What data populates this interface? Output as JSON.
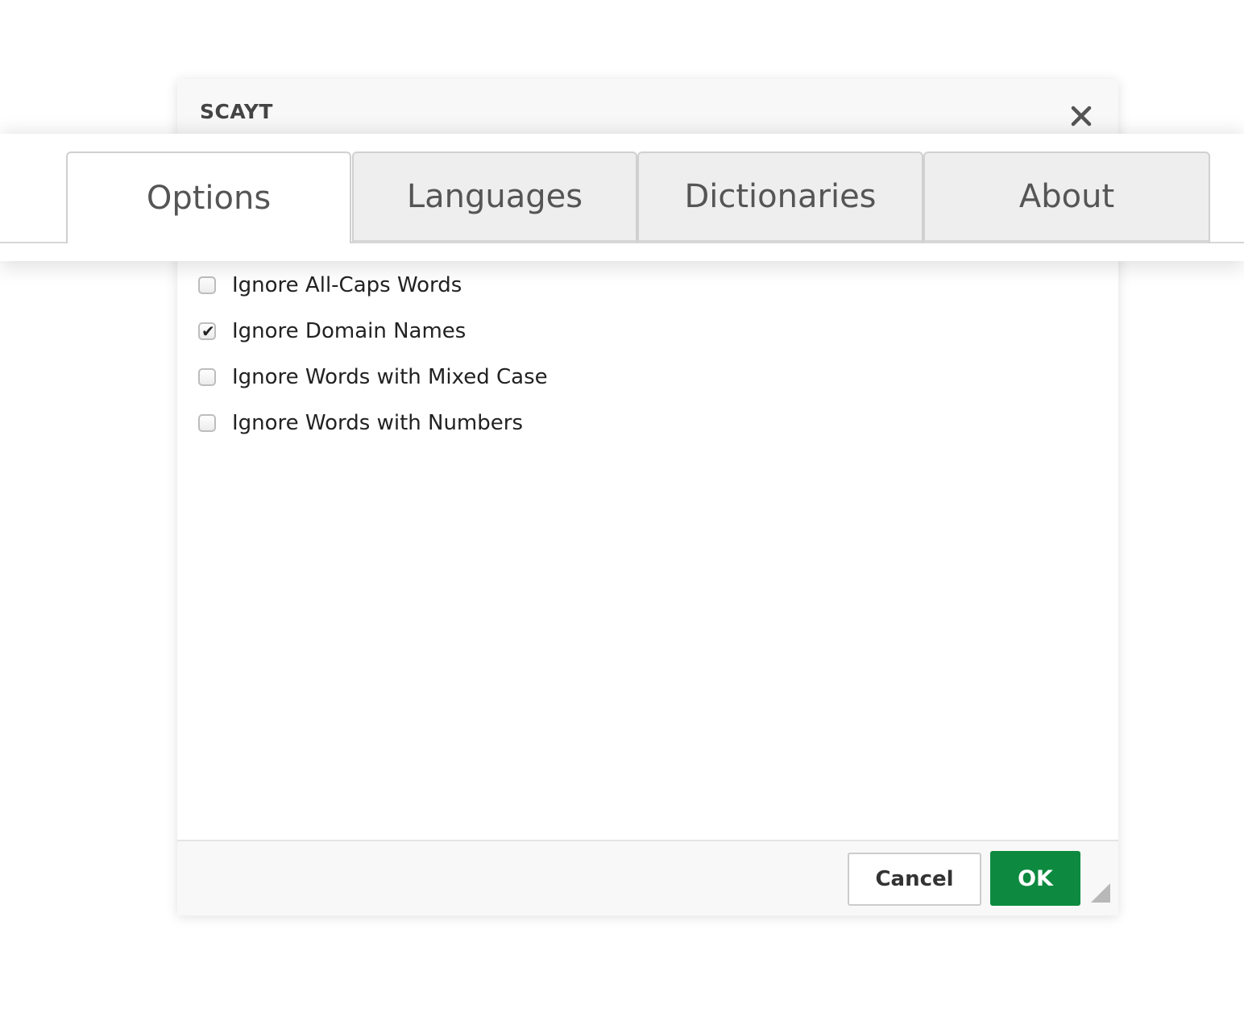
{
  "dialog": {
    "title": "SCAYT",
    "close_icon": "close-icon"
  },
  "tabs": [
    {
      "label": "Options",
      "active": true
    },
    {
      "label": "Languages",
      "active": false
    },
    {
      "label": "Dictionaries",
      "active": false
    },
    {
      "label": "About",
      "active": false
    }
  ],
  "options": [
    {
      "label": "Ignore All-Caps Words",
      "checked": false
    },
    {
      "label": "Ignore Domain Names",
      "checked": true
    },
    {
      "label": "Ignore Words with Mixed Case",
      "checked": false
    },
    {
      "label": "Ignore Words with Numbers",
      "checked": false
    }
  ],
  "footer": {
    "cancel_label": "Cancel",
    "ok_label": "OK",
    "resize_icon": "resize-handle-icon"
  },
  "colors": {
    "ok_button": "#0d8a3f",
    "title_bar": "#f8f8f8",
    "text": "#222222"
  }
}
